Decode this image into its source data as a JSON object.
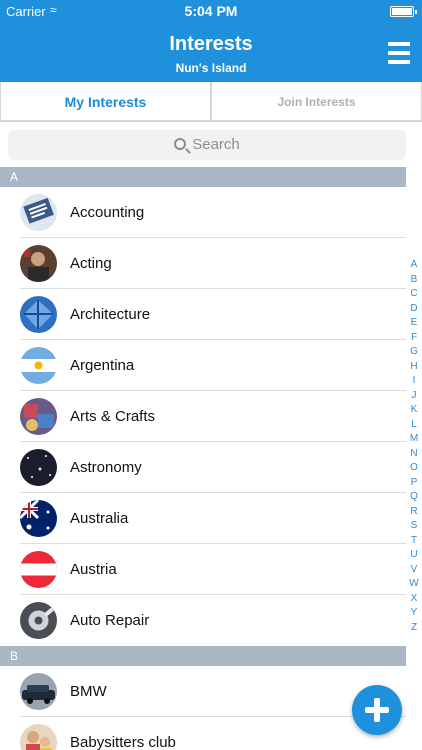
{
  "status": {
    "carrier": "Carrier",
    "time": "5:04 PM"
  },
  "header": {
    "title": "Interests",
    "subtitle": "Nun's Island"
  },
  "tabs": [
    {
      "label": "My Interests",
      "active": true
    },
    {
      "label": "Join Interests",
      "active": false
    }
  ],
  "search": {
    "placeholder": "Search"
  },
  "sections": [
    {
      "letter": "A",
      "items": [
        {
          "label": "Accounting",
          "icon": "accounting-icon"
        },
        {
          "label": "Acting",
          "icon": "acting-icon"
        },
        {
          "label": "Architecture",
          "icon": "architecture-icon"
        },
        {
          "label": "Argentina",
          "icon": "argentina-flag-icon"
        },
        {
          "label": "Arts & Crafts",
          "icon": "arts-crafts-icon"
        },
        {
          "label": "Astronomy",
          "icon": "astronomy-icon"
        },
        {
          "label": "Australia",
          "icon": "australia-flag-icon"
        },
        {
          "label": "Austria",
          "icon": "austria-flag-icon"
        },
        {
          "label": "Auto Repair",
          "icon": "auto-repair-icon"
        }
      ]
    },
    {
      "letter": "B",
      "items": [
        {
          "label": "BMW",
          "icon": "bmw-icon"
        },
        {
          "label": "Babysitters club",
          "icon": "babysitters-icon"
        }
      ]
    }
  ],
  "index_letters": [
    "A",
    "B",
    "C",
    "D",
    "E",
    "F",
    "G",
    "H",
    "I",
    "J",
    "K",
    "L",
    "M",
    "N",
    "O",
    "P",
    "Q",
    "R",
    "S",
    "T",
    "U",
    "V",
    "W",
    "X",
    "Y",
    "Z"
  ],
  "colors": {
    "accent": "#1e90dc",
    "section_header": "#a9b8c4"
  }
}
